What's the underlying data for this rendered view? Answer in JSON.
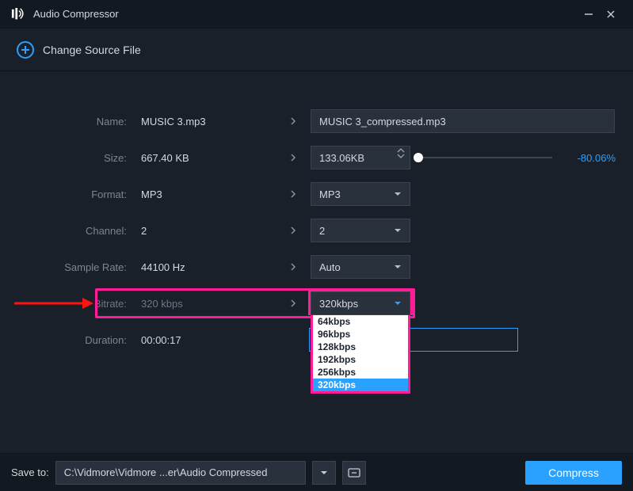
{
  "titlebar": {
    "title": "Audio Compressor"
  },
  "change_source": {
    "label": "Change Source File"
  },
  "labels": {
    "name": "Name:",
    "size": "Size:",
    "format": "Format:",
    "channel": "Channel:",
    "sample_rate": "Sample Rate:",
    "bitrate": "Bitrate:",
    "duration": "Duration:"
  },
  "values": {
    "name": "MUSIC 3.mp3",
    "size": "667.40 KB",
    "format": "MP3",
    "channel": "2",
    "sample_rate": "44100 Hz",
    "bitrate": "320 kbps",
    "duration": "00:00:17"
  },
  "inputs": {
    "out_name": "MUSIC 3_compressed.mp3",
    "out_size": "133.06KB",
    "size_delta": "-80.06%",
    "format_sel": "MP3",
    "channel_sel": "2",
    "sample_rate_sel": "Auto",
    "bitrate_sel": "320kbps"
  },
  "bitrate_options": [
    "64kbps",
    "96kbps",
    "128kbps",
    "192kbps",
    "256kbps",
    "320kbps"
  ],
  "footer": {
    "save_to": "Save to:",
    "path": "C:\\Vidmore\\Vidmore ...er\\Audio Compressed",
    "compress": "Compress"
  }
}
